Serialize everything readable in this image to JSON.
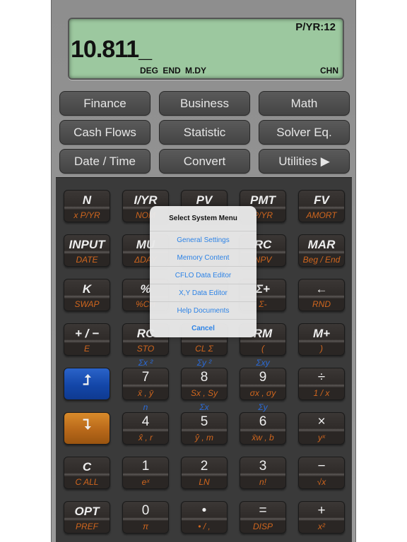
{
  "status_corner": "2",
  "display": {
    "value": "10.811_",
    "pyr": "P/YR:12",
    "annunciators": "DEG END M.DY",
    "mode": "CHN",
    "color": "#9cc89f"
  },
  "menu_buttons": [
    "Finance",
    "Business",
    "Math",
    "Cash Flows",
    "Statistic",
    "Solver Eq.",
    "Date / Time",
    "Convert",
    "Utilities ▶"
  ],
  "keys": [
    {
      "m": "N",
      "s": "x P/YR"
    },
    {
      "m": "I/YR",
      "s": "NOM"
    },
    {
      "m": "PV",
      "s": ""
    },
    {
      "m": "PMT",
      "s": "P/YR"
    },
    {
      "m": "FV",
      "s": "AMORT"
    },
    {
      "m": "INPUT",
      "s": "DATE"
    },
    {
      "m": "MU",
      "s": "ΔDAY"
    },
    {
      "m": "",
      "s": ""
    },
    {
      "m": "RC",
      "s": "NPV"
    },
    {
      "m": "MAR",
      "s": "Beg / End"
    },
    {
      "m": "K",
      "s": "SWAP"
    },
    {
      "m": "%",
      "s": "%CH"
    },
    {
      "m": "",
      "s": ""
    },
    {
      "m": "Σ+",
      "s": "Σ-"
    },
    {
      "m": "←",
      "s": "RND"
    },
    {
      "m": "+ / −",
      "s": "E"
    },
    {
      "m": "RC",
      "s": "STO"
    },
    {
      "m": "",
      "s": "CL Σ"
    },
    {
      "m": "RM",
      "s": "("
    },
    {
      "m": "M+",
      "s": ")"
    },
    {
      "m": "⮥",
      "s": "",
      "style": "blue",
      "icon": "shift-up-icon"
    },
    {
      "m": "7",
      "s": "x̄ , ȳ",
      "a": "Σx ²",
      "d": true
    },
    {
      "m": "8",
      "s": "Sx , Sy",
      "a": "Σy ²",
      "d": true
    },
    {
      "m": "9",
      "s": "σx , σy",
      "a": "Σxy",
      "d": true
    },
    {
      "m": "÷",
      "s": "1 / x",
      "d": true
    },
    {
      "m": "⮧",
      "s": "",
      "style": "orange",
      "icon": "shift-down-icon"
    },
    {
      "m": "4",
      "s": "x̂ , r",
      "a": "n",
      "d": true
    },
    {
      "m": "5",
      "s": "ŷ , m",
      "a": "Σx",
      "d": true
    },
    {
      "m": "6",
      "s": "x̄w , b",
      "a": "Σy",
      "d": true
    },
    {
      "m": "×",
      "s": "yˣ",
      "d": true
    },
    {
      "m": "C",
      "s": "C ALL"
    },
    {
      "m": "1",
      "s": "eˣ",
      "d": true
    },
    {
      "m": "2",
      "s": "LN",
      "d": true
    },
    {
      "m": "3",
      "s": "n!",
      "d": true
    },
    {
      "m": "−",
      "s": "√x",
      "d": true
    },
    {
      "m": "OPT",
      "s": "PREF"
    },
    {
      "m": "0",
      "s": "π",
      "d": true
    },
    {
      "m": "•",
      "s": "• / ,",
      "d": true
    },
    {
      "m": "=",
      "s": "DISP",
      "d": true
    },
    {
      "m": "+",
      "s": "x²",
      "d": true
    }
  ],
  "dialog": {
    "title": "Select System Menu",
    "items": [
      "General Settings",
      "Memory Content",
      "CFLO Data Editor",
      "X,Y Data Editor",
      "Help Documents",
      "Cancel"
    ],
    "accent": "#2d83e6"
  }
}
